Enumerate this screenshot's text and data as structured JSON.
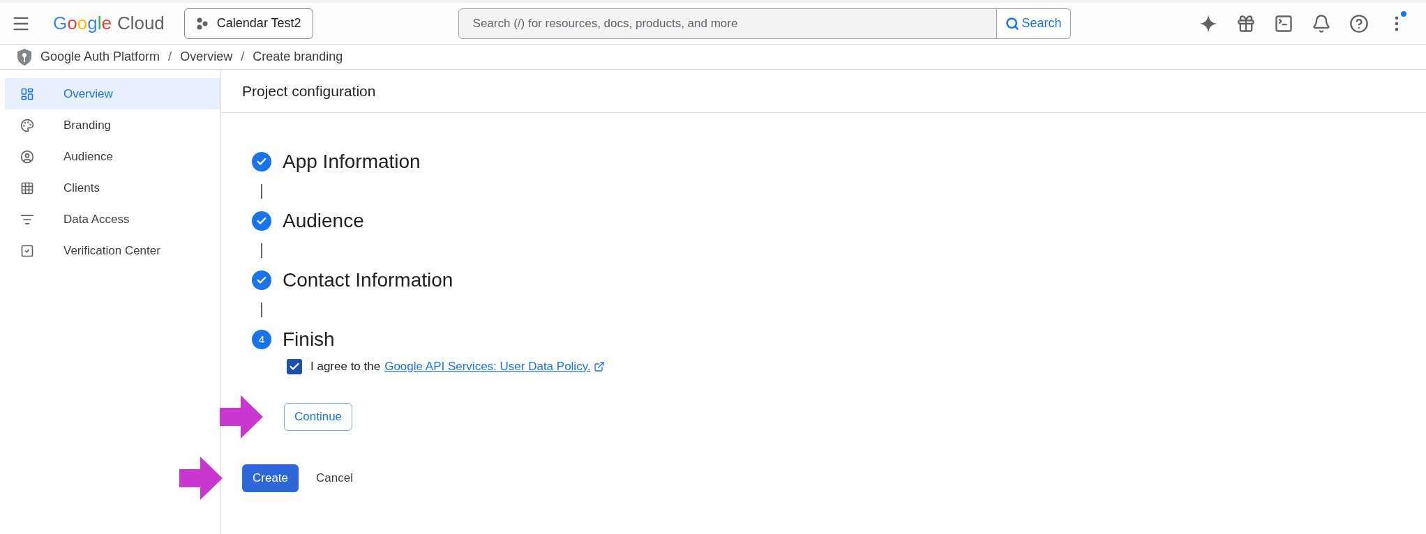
{
  "header": {
    "logo_word": "Google",
    "logo_product": "Cloud",
    "project": "Calendar Test2",
    "search": {
      "placeholder": "Search (/) for resources, docs, products, and more",
      "button": "Search"
    },
    "notification_dot": true
  },
  "breadcrumb": [
    "Google Auth Platform",
    "Overview",
    "Create branding"
  ],
  "breadcrumb_separator": "/",
  "sidebar": {
    "items": [
      {
        "label": "Overview",
        "selected": true
      },
      {
        "label": "Branding",
        "selected": false
      },
      {
        "label": "Audience",
        "selected": false
      },
      {
        "label": "Clients",
        "selected": false
      },
      {
        "label": "Data Access",
        "selected": false
      },
      {
        "label": "Verification Center",
        "selected": false
      }
    ]
  },
  "page_title": "Project configuration",
  "steps": [
    {
      "title": "App Information",
      "done": true
    },
    {
      "title": "Audience",
      "done": true
    },
    {
      "title": "Contact Information",
      "done": true
    },
    {
      "title": "Finish",
      "done": false,
      "number": "4"
    }
  ],
  "agreement": {
    "checked": true,
    "text": "I agree to the",
    "link": "Google API Services: User Data Policy."
  },
  "continue_button": "Continue",
  "create_button": "Create",
  "cancel_button": "Cancel",
  "annotations": [
    {
      "kind": "arrow"
    },
    {
      "kind": "arrow"
    }
  ]
}
